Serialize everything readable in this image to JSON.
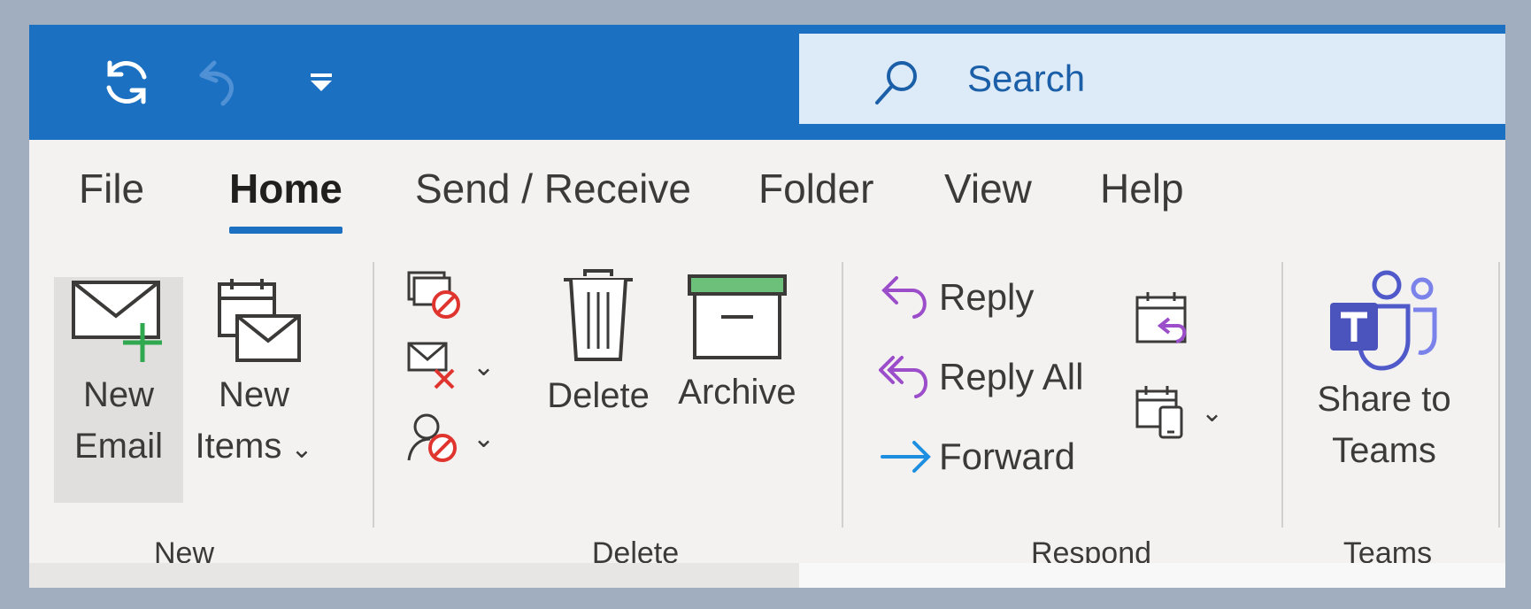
{
  "quick_access": {
    "sync_icon": "sync-icon",
    "undo_icon": "undo-icon",
    "customize_icon": "customize-icon"
  },
  "search": {
    "placeholder": "Search",
    "icon": "search-icon"
  },
  "tabs": [
    {
      "label": "File"
    },
    {
      "label": "Home",
      "active": true
    },
    {
      "label": "Send / Receive"
    },
    {
      "label": "Folder"
    },
    {
      "label": "View"
    },
    {
      "label": "Help"
    }
  ],
  "groups": {
    "new": {
      "label": "New",
      "new_email": {
        "line1": "New",
        "line2": "Email"
      },
      "new_items": {
        "line1": "New",
        "line2": "Items"
      }
    },
    "delete": {
      "label": "Delete",
      "delete_label": "Delete",
      "archive_label": "Archive"
    },
    "respond": {
      "label": "Respond",
      "reply": "Reply",
      "reply_all": "Reply All",
      "forward": "Forward"
    },
    "teams": {
      "label": "Teams",
      "share": {
        "line1": "Share to",
        "line2": "Teams"
      }
    }
  },
  "colors": {
    "titlebar": "#1b70c2",
    "search_bg": "#ddeaf7",
    "ribbon_bg": "#f3f2f1",
    "accent_green": "#2fa84f",
    "block_red": "#e0342f",
    "reply_purple": "#9b4dca",
    "forward_blue": "#1e8fe0",
    "teams_purple": "#5059c9"
  }
}
